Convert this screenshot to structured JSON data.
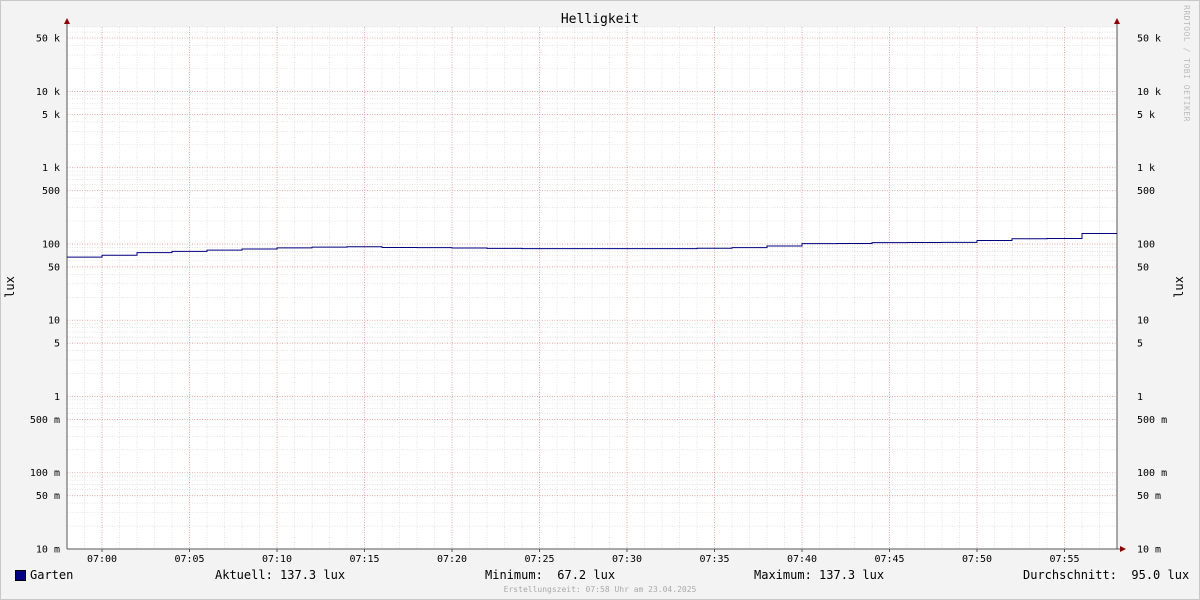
{
  "window": {
    "watermark": "RRDTOOL / TOBI OETIKER",
    "creation_time": "Erstellungszeit: 07:58 Uhr am 23.04.2025"
  },
  "chart_data": {
    "type": "line",
    "title": "Helligkeit",
    "ylabel": "lux",
    "y_scale": "log",
    "ylim": [
      0.01,
      70000
    ],
    "xlim": [
      "06:58",
      "07:58"
    ],
    "x_ticks": [
      "07:00",
      "07:05",
      "07:10",
      "07:15",
      "07:20",
      "07:25",
      "07:30",
      "07:35",
      "07:40",
      "07:45",
      "07:50",
      "07:55"
    ],
    "y_ticks": [
      {
        "value": 50000,
        "label": "50 k"
      },
      {
        "value": 10000,
        "label": "10 k"
      },
      {
        "value": 5000,
        "label": "5 k"
      },
      {
        "value": 1000,
        "label": "1 k"
      },
      {
        "value": 500,
        "label": "500"
      },
      {
        "value": 100,
        "label": "100"
      },
      {
        "value": 50,
        "label": "50"
      },
      {
        "value": 10,
        "label": "10"
      },
      {
        "value": 5,
        "label": "5"
      },
      {
        "value": 1,
        "label": "1"
      },
      {
        "value": 0.5,
        "label": "500 m"
      },
      {
        "value": 0.1,
        "label": "100 m"
      },
      {
        "value": 0.05,
        "label": "50 m"
      },
      {
        "value": 0.01,
        "label": "10 m"
      }
    ],
    "series": [
      {
        "name": "Garten",
        "color": "#000080",
        "x": [
          "06:58",
          "07:00",
          "07:02",
          "07:04",
          "07:06",
          "07:08",
          "07:10",
          "07:12",
          "07:14",
          "07:16",
          "07:18",
          "07:20",
          "07:22",
          "07:24",
          "07:26",
          "07:28",
          "07:30",
          "07:32",
          "07:34",
          "07:36",
          "07:38",
          "07:40",
          "07:42",
          "07:44",
          "07:46",
          "07:48",
          "07:50",
          "07:52",
          "07:54",
          "07:56",
          "07:58"
        ],
        "values": [
          67.2,
          71,
          77,
          80,
          83,
          86,
          89,
          91,
          92,
          90,
          89.5,
          88.5,
          87.5,
          87,
          87,
          87,
          87,
          87,
          88,
          89.5,
          94,
          101,
          101.5,
          104,
          104.5,
          104.8,
          111,
          117,
          118,
          137.3,
          137.3
        ]
      }
    ]
  },
  "legend": {
    "series_name": "Garten",
    "current": "Aktuell: 137.3 lux",
    "minimum": "Minimum:  67.2 lux",
    "maximum": "Maximum: 137.3 lux",
    "average": "Durchschnitt:  95.0 lux"
  }
}
